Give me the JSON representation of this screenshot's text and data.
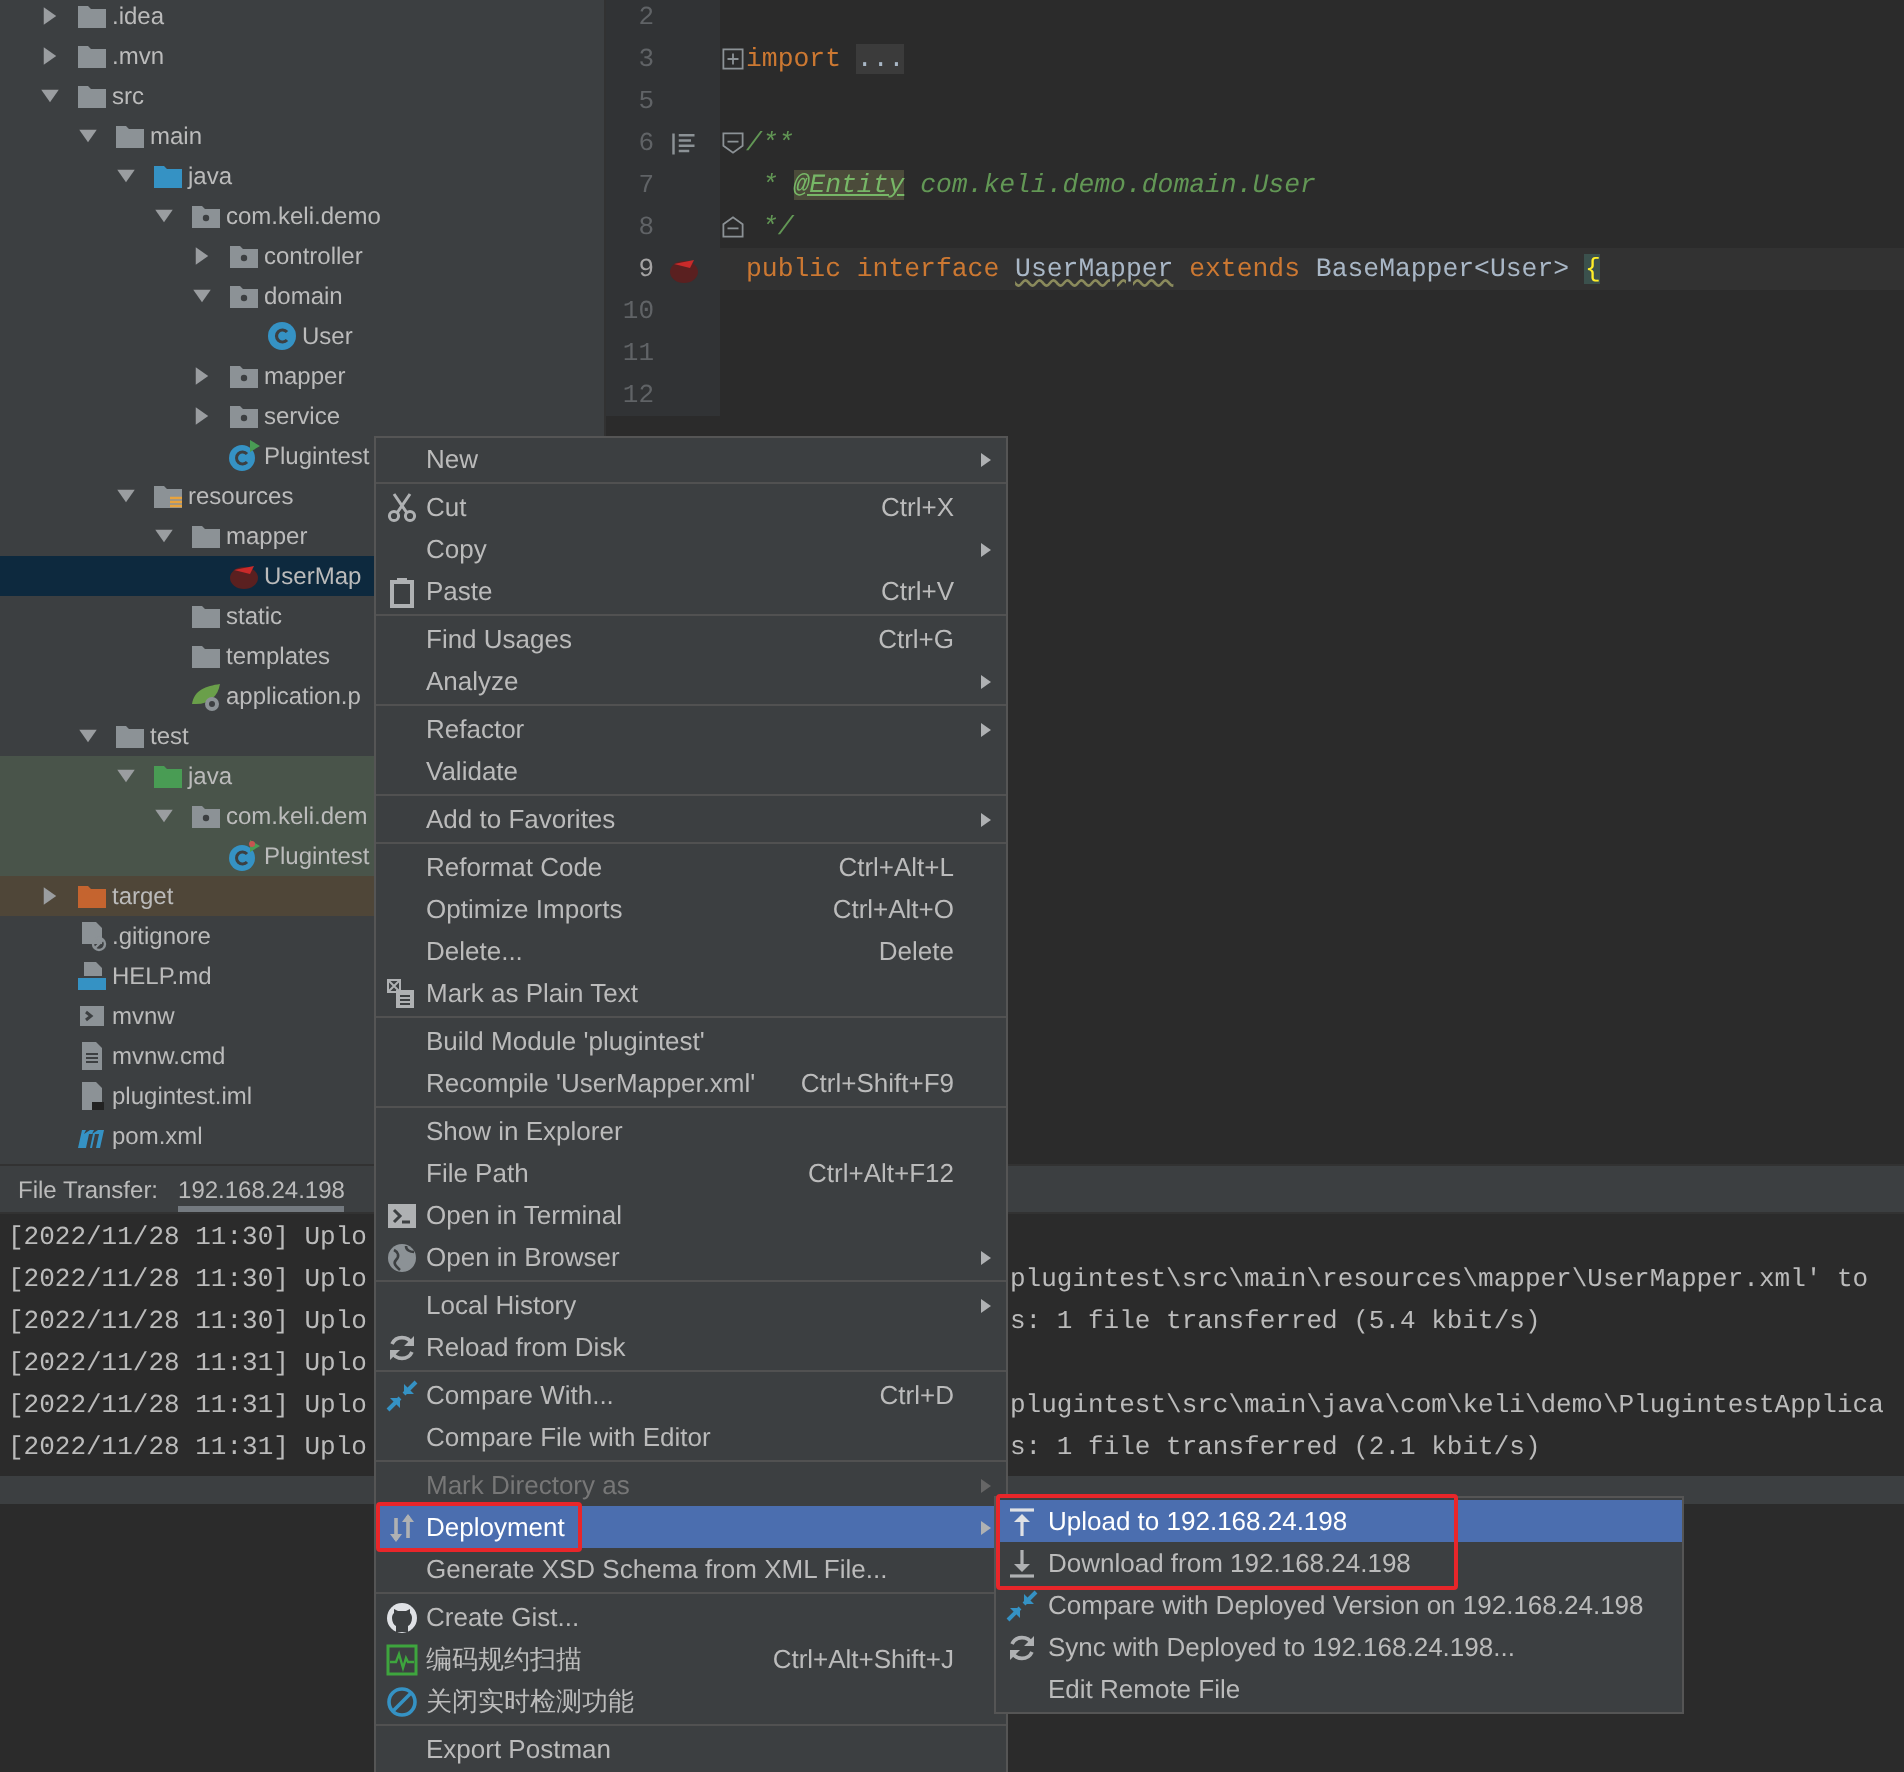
{
  "project_tree": [
    {
      "name": ".idea",
      "kind": "folder",
      "expanded": false,
      "selected": false
    },
    {
      "name": ".mvn",
      "kind": "folder",
      "expanded": false,
      "selected": false
    },
    {
      "name": "src",
      "kind": "folder",
      "expanded": true,
      "selected": false,
      "children": [
        {
          "name": "main",
          "kind": "folder",
          "expanded": true,
          "selected": false,
          "children": [
            {
              "name": "java",
              "kind": "source-root",
              "expanded": true,
              "selected": false,
              "children": [
                {
                  "name": "com.keli.demo",
                  "kind": "package",
                  "expanded": true,
                  "selected": false,
                  "children": [
                    {
                      "name": "controller",
                      "kind": "package",
                      "expanded": false,
                      "selected": false
                    },
                    {
                      "name": "domain",
                      "kind": "package",
                      "expanded": true,
                      "selected": false,
                      "children": [
                        {
                          "name": "User",
                          "kind": "class",
                          "selected": false
                        }
                      ]
                    },
                    {
                      "name": "mapper",
                      "kind": "package",
                      "expanded": false,
                      "selected": false
                    },
                    {
                      "name": "service",
                      "kind": "package",
                      "expanded": false,
                      "selected": false
                    },
                    {
                      "name": "Plugintest",
                      "kind": "spring-class",
                      "selected": false
                    }
                  ]
                }
              ]
            },
            {
              "name": "resources",
              "kind": "resources-root",
              "expanded": true,
              "selected": false,
              "children": [
                {
                  "name": "mapper",
                  "kind": "folder",
                  "expanded": true,
                  "selected": false,
                  "children": [
                    {
                      "name": "UserMap",
                      "kind": "mybatis-xml",
                      "selected": true
                    }
                  ]
                },
                {
                  "name": "static",
                  "kind": "folder",
                  "selected": false
                },
                {
                  "name": "templates",
                  "kind": "folder",
                  "selected": false
                },
                {
                  "name": "application.p",
                  "kind": "spring-config",
                  "selected": false
                }
              ]
            }
          ]
        },
        {
          "name": "test",
          "kind": "folder",
          "expanded": true,
          "selected": false,
          "children": [
            {
              "name": "java",
              "kind": "test-root",
              "expanded": true,
              "selected": false,
              "children": [
                {
                  "name": "com.keli.dem",
                  "kind": "test-package",
                  "expanded": true,
                  "selected": false,
                  "children": [
                    {
                      "name": "Plugintest",
                      "kind": "test-class",
                      "selected": false
                    }
                  ]
                }
              ]
            }
          ]
        }
      ]
    },
    {
      "name": "target",
      "kind": "excluded-folder",
      "expanded": false,
      "selected": false
    },
    {
      "name": ".gitignore",
      "kind": "ignore-file",
      "selected": false
    },
    {
      "name": "HELP.md",
      "kind": "markdown",
      "selected": false
    },
    {
      "name": "mvnw",
      "kind": "script",
      "selected": false
    },
    {
      "name": "mvnw.cmd",
      "kind": "text-file",
      "selected": false
    },
    {
      "name": "plugintest.iml",
      "kind": "iml",
      "selected": false
    },
    {
      "name": "pom.xml",
      "kind": "maven",
      "selected": false
    }
  ],
  "editor": {
    "lines": [
      {
        "number": "2",
        "kind": "plain",
        "current": false
      },
      {
        "number": "3",
        "kind": "fold-collapsed",
        "current": false,
        "segments": [
          {
            "kind": "keyword",
            "text": "import "
          },
          {
            "kind": "folded",
            "text": "..."
          }
        ]
      },
      {
        "number": "5",
        "kind": "plain",
        "current": false
      },
      {
        "number": "6",
        "kind": "doc-start",
        "current": false,
        "segments": [
          {
            "kind": "comment",
            "text": "/**"
          }
        ]
      },
      {
        "number": "7",
        "kind": "plain",
        "current": false,
        "segments": [
          {
            "kind": "comment",
            "text": " * "
          },
          {
            "kind": "annotation",
            "text": "@Entity"
          },
          {
            "kind": "comment",
            "text": " com.keli.demo.domain.User"
          }
        ]
      },
      {
        "number": "8",
        "kind": "fold-end",
        "current": false,
        "segments": [
          {
            "kind": "comment",
            "text": " */"
          }
        ]
      },
      {
        "number": "9",
        "kind": "mapper",
        "current": true,
        "segments": [
          {
            "kind": "keyword",
            "text": "public interface "
          },
          {
            "kind": "type",
            "text": "UserMapper"
          },
          {
            "kind": "keyword",
            "text": " extends"
          },
          {
            "kind": "plain",
            "text": " BaseMapper<User> "
          },
          {
            "kind": "brace",
            "text": "{"
          }
        ]
      },
      {
        "number": "10",
        "kind": "plain",
        "current": false
      },
      {
        "number": "11",
        "kind": "plain",
        "current": false
      },
      {
        "number": "12",
        "kind": "plain",
        "current": false
      }
    ]
  },
  "bottom_panel": {
    "label": "File Transfer:",
    "tabs": [
      {
        "label": "192.168.24.198",
        "selected": true
      }
    ],
    "log": [
      {
        "prefix": "[2022/11/28 11:30] Uplo"
      },
      {
        "prefix": "[2022/11/28 11:30] Uplo",
        "rest": "plugintest\\src\\main\\resources\\mapper\\UserMapper.xml' to"
      },
      {
        "prefix": "[2022/11/28 11:30] Uplo",
        "rest": "s: 1 file transferred (5.4 kbit/s)"
      },
      {
        "prefix": "[2022/11/28 11:31] Uplo"
      },
      {
        "prefix": "[2022/11/28 11:31] Uplo",
        "rest": "plugintest\\src\\main\\java\\com\\keli\\demo\\PlugintestApplica"
      },
      {
        "prefix": "[2022/11/28 11:31] Uplo",
        "rest": "s: 1 file transferred (2.1 kbit/s)"
      }
    ]
  },
  "context_menu": [
    {
      "kind": "plain",
      "label": "New",
      "submenu": true,
      "disabled": false,
      "selected": false,
      "boxed": false
    },
    {
      "kind": "separator"
    },
    {
      "kind": "scissors",
      "label": "Cut",
      "shortcut": "Ctrl+X",
      "submenu": false,
      "disabled": false,
      "selected": false,
      "boxed": false
    },
    {
      "kind": "plain",
      "label": "Copy",
      "submenu": true,
      "disabled": false,
      "selected": false,
      "boxed": false
    },
    {
      "kind": "clipboard",
      "label": "Paste",
      "shortcut": "Ctrl+V",
      "submenu": false,
      "disabled": false,
      "selected": false,
      "boxed": false
    },
    {
      "kind": "separator"
    },
    {
      "kind": "plain",
      "label": "Find Usages",
      "shortcut": "Ctrl+G",
      "submenu": false,
      "disabled": false,
      "selected": false,
      "boxed": false
    },
    {
      "kind": "plain",
      "label": "Analyze",
      "submenu": true,
      "disabled": false,
      "selected": false,
      "boxed": false
    },
    {
      "kind": "separator"
    },
    {
      "kind": "plain",
      "label": "Refactor",
      "submenu": true,
      "disabled": false,
      "selected": false,
      "boxed": false
    },
    {
      "kind": "plain",
      "label": "Validate",
      "submenu": false,
      "disabled": false,
      "selected": false,
      "boxed": false
    },
    {
      "kind": "separator"
    },
    {
      "kind": "plain",
      "label": "Add to Favorites",
      "submenu": true,
      "disabled": false,
      "selected": false,
      "boxed": false
    },
    {
      "kind": "separator"
    },
    {
      "kind": "plain",
      "label": "Reformat Code",
      "shortcut": "Ctrl+Alt+L",
      "submenu": false,
      "disabled": false,
      "selected": false,
      "boxed": false
    },
    {
      "kind": "plain",
      "label": "Optimize Imports",
      "shortcut": "Ctrl+Alt+O",
      "submenu": false,
      "disabled": false,
      "selected": false,
      "boxed": false
    },
    {
      "kind": "plain",
      "label": "Delete...",
      "shortcut": "Delete",
      "submenu": false,
      "disabled": false,
      "selected": false,
      "boxed": false
    },
    {
      "kind": "plain-text",
      "label": "Mark as Plain Text",
      "submenu": false,
      "disabled": false,
      "selected": false,
      "boxed": false
    },
    {
      "kind": "separator"
    },
    {
      "kind": "plain",
      "label": "Build Module 'plugintest'",
      "submenu": false,
      "disabled": false,
      "selected": false,
      "boxed": false
    },
    {
      "kind": "plain",
      "label": "Recompile 'UserMapper.xml'",
      "shortcut": "Ctrl+Shift+F9",
      "submenu": false,
      "disabled": false,
      "selected": false,
      "boxed": false
    },
    {
      "kind": "separator"
    },
    {
      "kind": "plain",
      "label": "Show in Explorer",
      "submenu": false,
      "disabled": false,
      "selected": false,
      "boxed": false
    },
    {
      "kind": "plain",
      "label": "File Path",
      "shortcut": "Ctrl+Alt+F12",
      "submenu": false,
      "disabled": false,
      "selected": false,
      "boxed": false
    },
    {
      "kind": "terminal",
      "label": "Open in Terminal",
      "submenu": false,
      "disabled": false,
      "selected": false,
      "boxed": false
    },
    {
      "kind": "globe",
      "label": "Open in Browser",
      "submenu": true,
      "disabled": false,
      "selected": false,
      "boxed": false
    },
    {
      "kind": "separator"
    },
    {
      "kind": "plain",
      "label": "Local History",
      "submenu": true,
      "disabled": false,
      "selected": false,
      "boxed": false
    },
    {
      "kind": "reload",
      "label": "Reload from Disk",
      "submenu": false,
      "disabled": false,
      "selected": false,
      "boxed": false
    },
    {
      "kind": "separator"
    },
    {
      "kind": "compare",
      "label": "Compare With...",
      "shortcut": "Ctrl+D",
      "submenu": false,
      "disabled": false,
      "selected": false,
      "boxed": false
    },
    {
      "kind": "plain",
      "label": "Compare File with Editor",
      "submenu": false,
      "disabled": false,
      "selected": false,
      "boxed": false
    },
    {
      "kind": "separator"
    },
    {
      "kind": "plain",
      "label": "Mark Directory as",
      "submenu": true,
      "disabled": true,
      "selected": false,
      "boxed": false
    },
    {
      "kind": "deploy",
      "label": "Deployment",
      "submenu": true,
      "disabled": false,
      "selected": true,
      "boxed": true
    },
    {
      "kind": "plain",
      "label": "Generate XSD Schema from XML File...",
      "submenu": false,
      "disabled": false,
      "selected": false,
      "boxed": false
    },
    {
      "kind": "separator"
    },
    {
      "kind": "github",
      "label": "Create Gist...",
      "submenu": false,
      "disabled": false,
      "selected": false,
      "boxed": false
    },
    {
      "kind": "scan",
      "label": "编码规约扫描",
      "shortcut": "Ctrl+Alt+Shift+J",
      "submenu": false,
      "disabled": false,
      "selected": false,
      "boxed": false
    },
    {
      "kind": "prohibit",
      "label": "关闭实时检测功能",
      "submenu": false,
      "disabled": false,
      "selected": false,
      "boxed": false
    },
    {
      "kind": "separator"
    },
    {
      "kind": "plain",
      "label": "Export Postman",
      "submenu": false,
      "disabled": false,
      "selected": false,
      "boxed": false
    }
  ],
  "deployment_submenu": [
    {
      "kind": "upload",
      "label": "Upload to 192.168.24.198",
      "selected": true,
      "boxed": true
    },
    {
      "kind": "download",
      "label": "Download from 192.168.24.198",
      "selected": false,
      "boxed": true
    },
    {
      "kind": "compare",
      "label": "Compare with Deployed Version on 192.168.24.198",
      "selected": false,
      "boxed": false
    },
    {
      "kind": "reload",
      "label": "Sync with Deployed to 192.168.24.198...",
      "selected": false,
      "boxed": false
    },
    {
      "kind": "plain",
      "label": "Edit Remote File",
      "selected": false,
      "boxed": false
    }
  ]
}
